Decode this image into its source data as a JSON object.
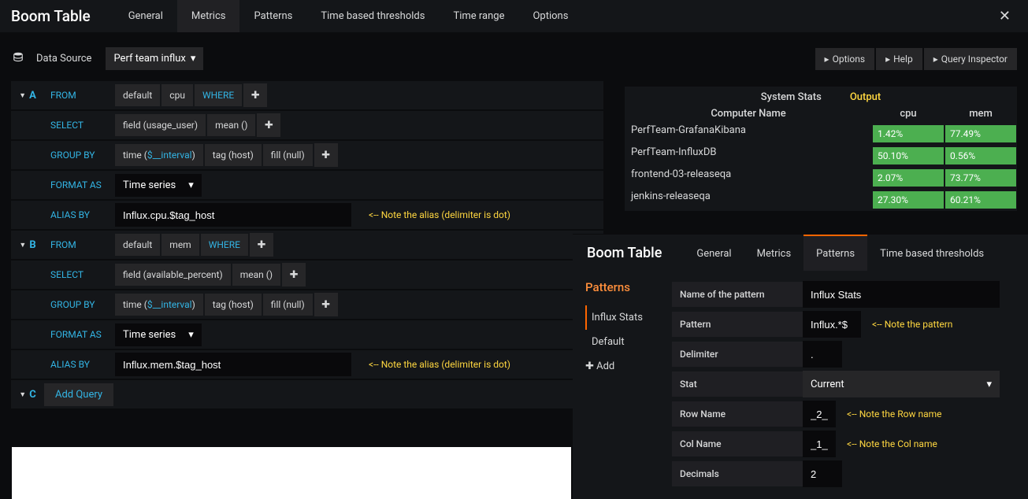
{
  "header": {
    "title": "Boom Table",
    "tabs": [
      "General",
      "Metrics",
      "Patterns",
      "Time based thresholds",
      "Time range",
      "Options"
    ],
    "close": "✕"
  },
  "datasource": {
    "label": "Data Source",
    "selected": "Perf team influx",
    "buttons": {
      "options": "Options",
      "help": "Help",
      "inspector": "Query Inspector"
    }
  },
  "queries": {
    "A": {
      "letter": "A",
      "from": {
        "label": "FROM",
        "default": "default",
        "measurement": "cpu",
        "where": "WHERE"
      },
      "select": {
        "label": "SELECT",
        "field": "field (usage_user)",
        "agg": "mean ()"
      },
      "groupby": {
        "label": "GROUP BY",
        "time_prefix": "time (",
        "interval": "$__interval",
        "time_suffix": ")",
        "tag": "tag (host)",
        "fill": "fill (null)"
      },
      "format": {
        "label": "FORMAT AS",
        "value": "Time series"
      },
      "alias": {
        "label": "ALIAS BY",
        "value": "Influx.cpu.$tag_host",
        "note": "<-- Note the alias (delimiter is dot)"
      }
    },
    "B": {
      "letter": "B",
      "from": {
        "label": "FROM",
        "default": "default",
        "measurement": "mem",
        "where": "WHERE"
      },
      "select": {
        "label": "SELECT",
        "field": "field (available_percent)",
        "agg": "mean ()"
      },
      "groupby": {
        "label": "GROUP BY",
        "time_prefix": "time (",
        "interval": "$__interval",
        "time_suffix": ")",
        "tag": "tag (host)",
        "fill": "fill (null)"
      },
      "format": {
        "label": "FORMAT AS",
        "value": "Time series"
      },
      "alias": {
        "label": "ALIAS BY",
        "value": "Influx.mem.$tag_host",
        "note": "<-- Note the alias (delimiter is dot)"
      }
    },
    "C": {
      "letter": "C",
      "add": "Add Query"
    }
  },
  "preview": {
    "title1": "System Stats",
    "title2": "Output",
    "col_name": "Computer Name",
    "col_cpu": "cpu",
    "col_mem": "mem",
    "rows": [
      {
        "name": "PerfTeam-GrafanaKibana",
        "cpu": "1.42%",
        "mem": "77.49%"
      },
      {
        "name": "PerfTeam-InfluxDB",
        "cpu": "50.10%",
        "mem": "0.56%"
      },
      {
        "name": "frontend-03-releaseqa",
        "cpu": "2.07%",
        "mem": "73.77%"
      },
      {
        "name": "jenkins-releaseqa",
        "cpu": "27.30%",
        "mem": "60.21%"
      }
    ]
  },
  "overlay": {
    "title": "Boom Table",
    "tabs": [
      "General",
      "Metrics",
      "Patterns",
      "Time based thresholds"
    ],
    "side": {
      "title": "Patterns",
      "items": [
        "Influx Stats",
        "Default"
      ],
      "add": "Add"
    },
    "form": {
      "name_label": "Name of the pattern",
      "name_value": "Influx Stats",
      "pattern_label": "Pattern",
      "pattern_value": "Influx.*$",
      "pattern_note": "<-- Note the pattern",
      "delimiter_label": "Delimiter",
      "delimiter_value": ".",
      "stat_label": "Stat",
      "stat_value": "Current",
      "rowname_label": "Row Name",
      "rowname_value": "_2_",
      "rowname_note": "<-- Note the Row name",
      "colname_label": "Col Name",
      "colname_value": "_1_",
      "colname_note": "<-- Note the Col name",
      "decimals_label": "Decimals",
      "decimals_value": "2"
    }
  }
}
